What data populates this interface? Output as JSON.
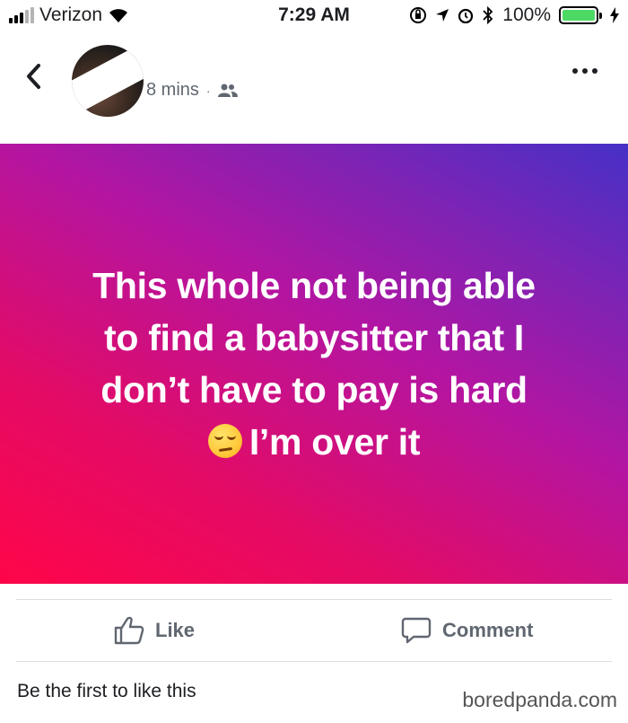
{
  "status_bar": {
    "carrier": "Verizon",
    "time": "7:29 AM",
    "battery_label": "100%",
    "battery_level": 1.0,
    "icons": [
      "signal-icon",
      "wifi-icon",
      "orientation-lock-icon",
      "location-icon",
      "alarm-icon",
      "bluetooth-icon",
      "battery-icon",
      "charging-icon"
    ]
  },
  "post": {
    "timestamp": "8 mins",
    "separator": "·",
    "audience_icon": "friends-icon",
    "text_lines": [
      "This whole not being able",
      "to find a babysitter that I",
      "don’t have to pay is hard"
    ],
    "last_line": "I’m over it",
    "emoji": "unamused-face",
    "background": {
      "from": "#ff0549",
      "mid": "#b315a2",
      "to": "#4630c6"
    }
  },
  "actions": {
    "like_label": "Like",
    "comment_label": "Comment"
  },
  "likes_summary": "Be the first to like this",
  "watermark": "boredpanda.com",
  "colors": {
    "action_gray": "#606770",
    "text": "#1c1e21",
    "battery_green": "#4cd964"
  }
}
